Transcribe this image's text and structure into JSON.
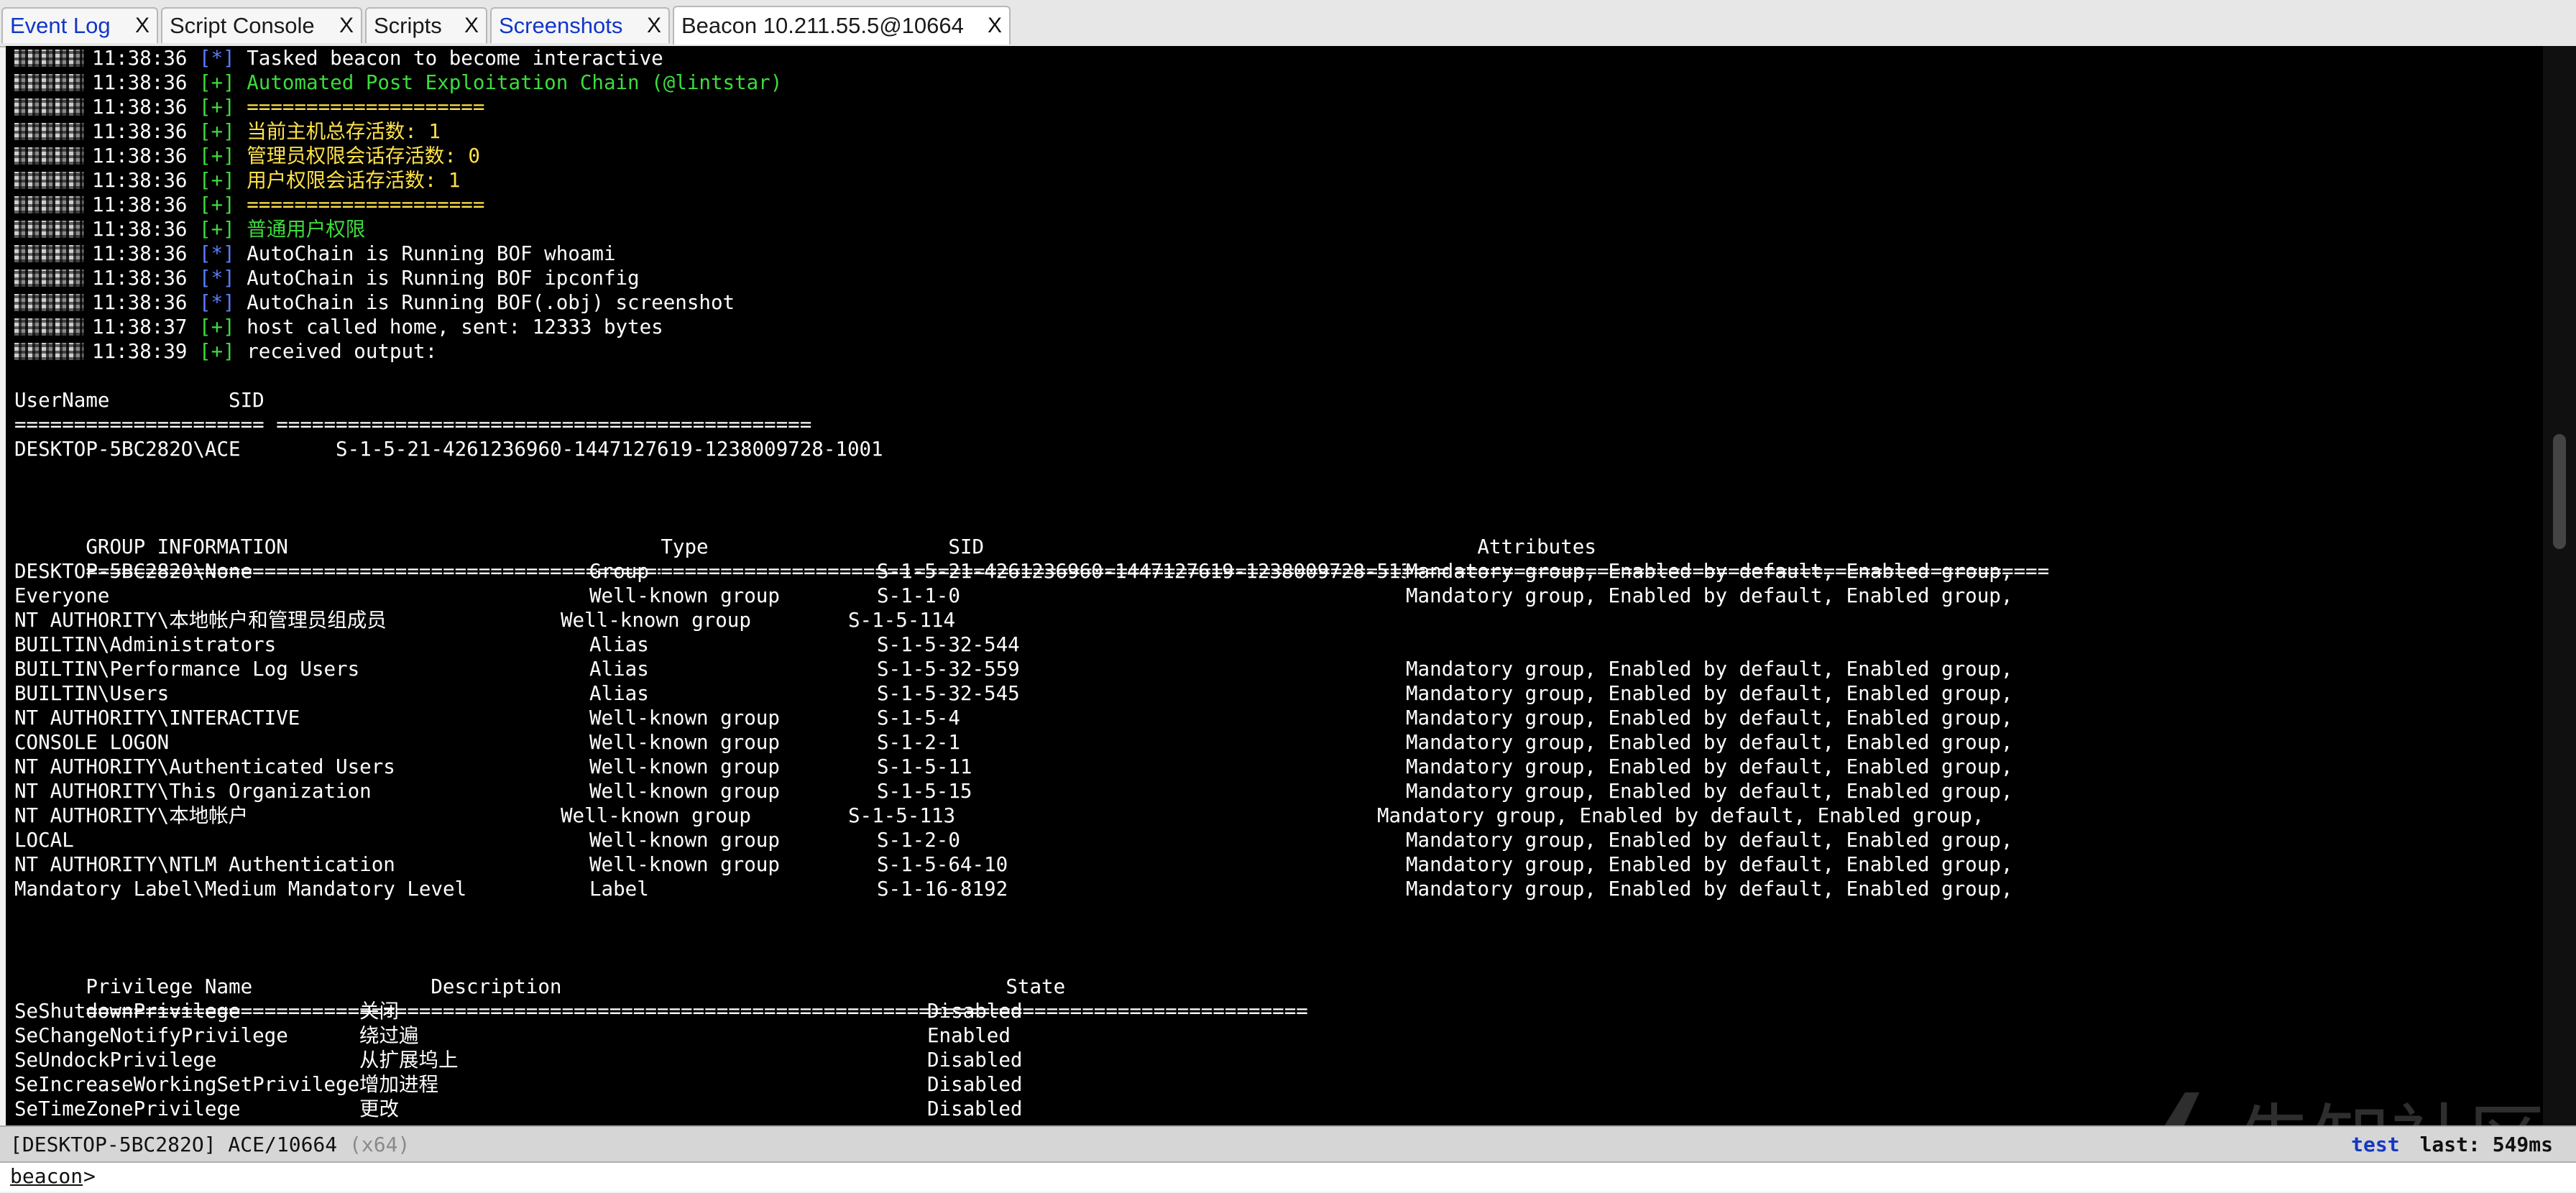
{
  "tabs": [
    {
      "label": "Event Log",
      "close": "X",
      "blue": true,
      "active": false
    },
    {
      "label": "Script Console",
      "close": "X",
      "blue": false,
      "active": false
    },
    {
      "label": "Scripts",
      "close": "X",
      "blue": false,
      "active": false
    },
    {
      "label": "Screenshots",
      "close": "X",
      "blue": true,
      "active": false
    },
    {
      "label": "Beacon 10.211.55.5@10664",
      "close": "X",
      "blue": false,
      "active": true
    }
  ],
  "log": [
    {
      "time": "11:38:36",
      "mark": "[*]",
      "text": "Tasked beacon to become interactive",
      "color": "white"
    },
    {
      "time": "11:38:36",
      "mark": "[+]",
      "text": "Automated Post Exploitation Chain (@lintstar)",
      "color": "green"
    },
    {
      "time": "11:38:36",
      "mark": "[+]",
      "text": "====================",
      "color": "yellow"
    },
    {
      "time": "11:38:36",
      "mark": "[+]",
      "text": "当前主机总存活数: 1",
      "color": "yellow"
    },
    {
      "time": "11:38:36",
      "mark": "[+]",
      "text": "管理员权限会话存活数: 0",
      "color": "yellow"
    },
    {
      "time": "11:38:36",
      "mark": "[+]",
      "text": "用户权限会话存活数: 1",
      "color": "yellow"
    },
    {
      "time": "11:38:36",
      "mark": "[+]",
      "text": "====================",
      "color": "yellow"
    },
    {
      "time": "11:38:36",
      "mark": "[+]",
      "text": "普通用户权限",
      "color": "green"
    },
    {
      "time": "11:38:36",
      "mark": "[*]",
      "text": "AutoChain is Running BOF whoami",
      "color": "white"
    },
    {
      "time": "11:38:36",
      "mark": "[*]",
      "text": "AutoChain is Running BOF ipconfig",
      "color": "white"
    },
    {
      "time": "11:38:36",
      "mark": "[*]",
      "text": "AutoChain is Running BOF(.obj) screenshot",
      "color": "white"
    },
    {
      "time": "11:38:37",
      "mark": "[+]",
      "text": "host called home, sent: 12333 bytes",
      "color": "white"
    },
    {
      "time": "11:38:39",
      "mark": "[+]",
      "text": "received output:",
      "color": "white"
    }
  ],
  "user_table": {
    "header": "UserName          SID",
    "rule": "===================== =============================================",
    "row": "DESKTOP-5BC282O\\ACE        S-1-5-21-4261236960-1447127619-1238009728-1001"
  },
  "group_table": {
    "headers": [
      "GROUP INFORMATION",
      "Type",
      "SID",
      "Attributes"
    ],
    "rules": [
      "==================================================",
      "=====================",
      "=============================================",
      "=================================================="
    ],
    "rows": [
      {
        "name": "DESKTOP-5BC282O\\None",
        "type": "Group",
        "sid": "S-1-5-21-4261236960-1447127619-1238009728-513",
        "attr": "Mandatory group, Enabled by default, Enabled group,"
      },
      {
        "name": "Everyone",
        "type": "Well-known group",
        "sid": "S-1-1-0",
        "attr": "Mandatory group, Enabled by default, Enabled group,"
      },
      {
        "name": "NT AUTHORITY\\本地帐户和管理员组成员",
        "type": "Well-known group",
        "sid": "S-1-5-114",
        "attr": "",
        "shift": true
      },
      {
        "name": "BUILTIN\\Administrators",
        "type": "Alias",
        "sid": "S-1-5-32-544",
        "attr": ""
      },
      {
        "name": "BUILTIN\\Performance Log Users",
        "type": "Alias",
        "sid": "S-1-5-32-559",
        "attr": "Mandatory group, Enabled by default, Enabled group,"
      },
      {
        "name": "BUILTIN\\Users",
        "type": "Alias",
        "sid": "S-1-5-32-545",
        "attr": "Mandatory group, Enabled by default, Enabled group,"
      },
      {
        "name": "NT AUTHORITY\\INTERACTIVE",
        "type": "Well-known group",
        "sid": "S-1-5-4",
        "attr": "Mandatory group, Enabled by default, Enabled group,"
      },
      {
        "name": "CONSOLE LOGON",
        "type": "Well-known group",
        "sid": "S-1-2-1",
        "attr": "Mandatory group, Enabled by default, Enabled group,"
      },
      {
        "name": "NT AUTHORITY\\Authenticated Users",
        "type": "Well-known group",
        "sid": "S-1-5-11",
        "attr": "Mandatory group, Enabled by default, Enabled group,"
      },
      {
        "name": "NT AUTHORITY\\This Organization",
        "type": "Well-known group",
        "sid": "S-1-5-15",
        "attr": "Mandatory group, Enabled by default, Enabled group,"
      },
      {
        "name": "NT AUTHORITY\\本地帐户",
        "type": "Well-known group",
        "sid": "S-1-5-113",
        "attr": "Mandatory group, Enabled by default, Enabled group,",
        "shift": true
      },
      {
        "name": "LOCAL",
        "type": "Well-known group",
        "sid": "S-1-2-0",
        "attr": "Mandatory group, Enabled by default, Enabled group,"
      },
      {
        "name": "NT AUTHORITY\\NTLM Authentication",
        "type": "Well-known group",
        "sid": "S-1-5-64-10",
        "attr": "Mandatory group, Enabled by default, Enabled group,"
      },
      {
        "name": "Mandatory Label\\Medium Mandatory Level",
        "type": "Label",
        "sid": "S-1-16-8192",
        "attr": "Mandatory group, Enabled by default, Enabled group,"
      }
    ]
  },
  "priv_table": {
    "headers": [
      "Privilege Name",
      "Description",
      "State"
    ],
    "rules": [
      "=============================",
      "====================================================",
      "=========================="
    ],
    "rows": [
      {
        "name": "SeShutdownPrivilege",
        "desc": "关闭",
        "state": "Disabled"
      },
      {
        "name": "SeChangeNotifyPrivilege",
        "desc": "绕过遍",
        "state": "Enabled"
      },
      {
        "name": "SeUndockPrivilege",
        "desc": "从扩展坞上",
        "state": "Disabled"
      },
      {
        "name": "SeIncreaseWorkingSetPrivilege",
        "desc": "增加进程",
        "state": "Disabled"
      },
      {
        "name": "SeTimeZonePrivilege",
        "desc": "更改",
        "state": "Disabled"
      }
    ]
  },
  "status": {
    "session": "[DESKTOP-5BC282O] ACE/10664",
    "arch": "(x64)",
    "user": "test",
    "last": "last: 549ms"
  },
  "input": {
    "prompt": "beacon",
    "gt": ">",
    "value": ""
  },
  "watermark": {
    "text": "先知社区"
  },
  "colors": {
    "star": "#5a7dff",
    "plus": "#3ddc3d",
    "yellow": "#ffe24a",
    "tab_blue": "#1136c8",
    "status_user": "#1638c0"
  }
}
